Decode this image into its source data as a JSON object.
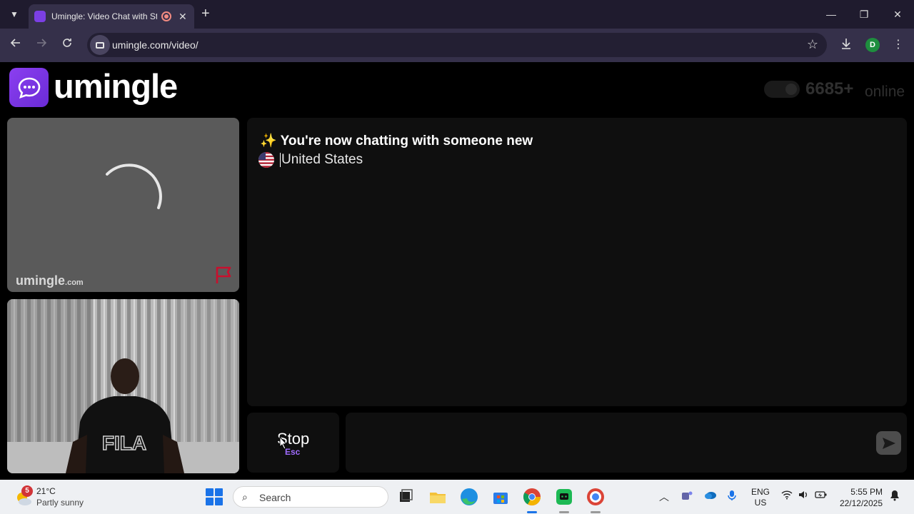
{
  "browser": {
    "tab": {
      "title": "Umingle: Video Chat with Strangers",
      "close_label": "✕"
    },
    "new_tab_label": "+",
    "url": "umingle.com/video/",
    "profile_initial": "D",
    "window_controls": {
      "minimize": "—",
      "restore": "❐",
      "close": "✕"
    }
  },
  "site": {
    "logo_text": "umingle",
    "online_count": "6685+",
    "online_label": "online",
    "watermark_main": "umingle",
    "watermark_suffix": ".com"
  },
  "chat": {
    "status_emoji": "✨",
    "status": "You're now chatting with someone new",
    "country": "United States",
    "message_placeholder": ""
  },
  "controls": {
    "stop_label": "Stop",
    "stop_hint": "Esc"
  },
  "taskbar": {
    "weather_badge": "5",
    "weather_temp": "21°C",
    "weather_desc": "Partly sunny",
    "search_label": "Search",
    "lang_line1": "ENG",
    "lang_line2": "US",
    "time": "5:55 PM",
    "date": "22/12/2025"
  },
  "colors": {
    "brand": "#7b3fe4",
    "accent_hint": "#a06cff",
    "panel_bg": "#0f0f0f"
  }
}
